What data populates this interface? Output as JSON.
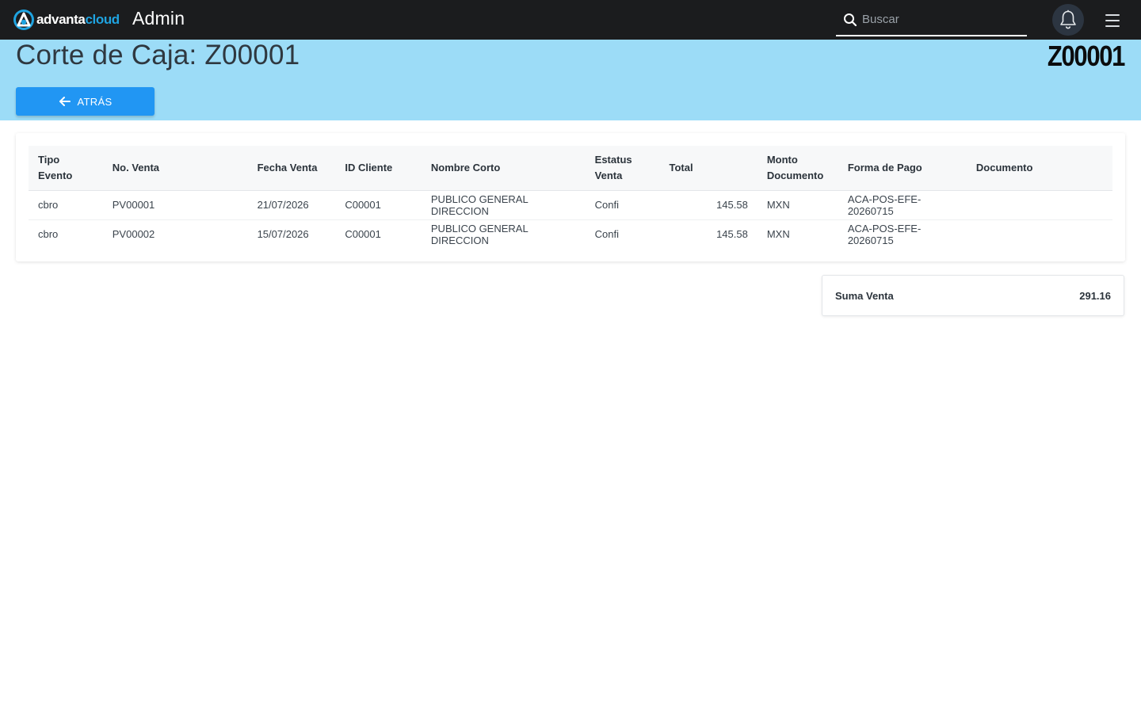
{
  "topbar": {
    "logo_text_primary": "advanta",
    "logo_text_secondary": "cloud",
    "app_title": "Admin",
    "search_placeholder": "Buscar",
    "search_value": "",
    "icons": [
      "logo-icon",
      "search-icon",
      "bell-icon",
      "hamburger-menu-icon"
    ]
  },
  "header": {
    "title": "Corte de Caja: Z00001",
    "code": "Z00001",
    "back_label": "ATRÁS",
    "band_color": "#9cdcf7",
    "button_color": "#2196f3"
  },
  "table": {
    "columns": [
      "Tipo Evento",
      "No. Venta",
      "Fecha Venta",
      "ID Cliente",
      "Nombre Corto",
      "Estatus Venta",
      "Total",
      "Monto Documento",
      "Forma de Pago",
      "Documento"
    ],
    "rows": [
      {
        "tipo_evento": "cbro",
        "no_venta": "PV00001",
        "fecha_venta": "21/07/2026",
        "id_cliente": "C00001",
        "nombre_corto": "PUBLICO GENERAL DIRECCION",
        "estatus_venta": "Confi",
        "total": "145.58",
        "monto_documento": "MXN",
        "forma_de_pago": "ACA-POS-EFE-20260715",
        "documento": ""
      },
      {
        "tipo_evento": "cbro",
        "no_venta": "PV00002",
        "fecha_venta": "15/07/2026",
        "id_cliente": "C00001",
        "nombre_corto": "PUBLICO GENERAL DIRECCION",
        "estatus_venta": "Confi",
        "total": "145.58",
        "monto_documento": "MXN",
        "forma_de_pago": "ACA-POS-EFE-20260715",
        "documento": ""
      }
    ]
  },
  "summary": {
    "label": "Suma Venta",
    "value": "291.16"
  }
}
